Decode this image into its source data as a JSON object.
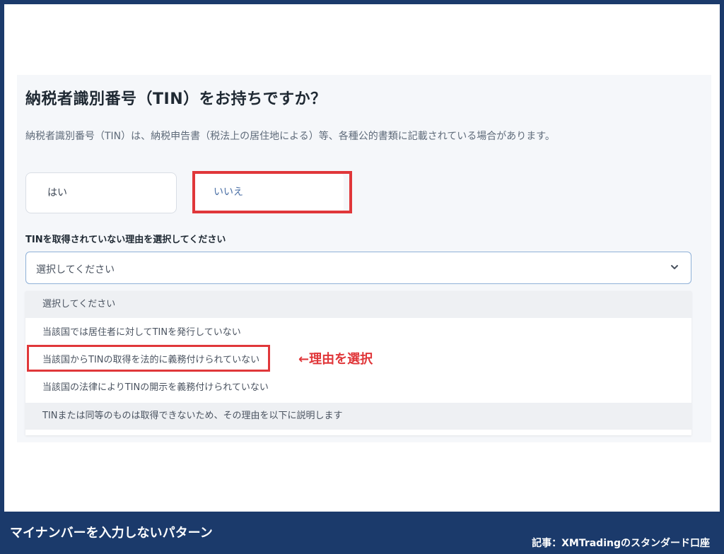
{
  "question": {
    "title": "納税者識別番号（TIN）をお持ちですか？",
    "description": "納税者識別番号（TIN）は、納税申告書（税法上の居住地による）等、各種公的書類に記載されている場合があります。",
    "options": [
      "はい",
      "いいえ"
    ],
    "selected": "いいえ"
  },
  "reason": {
    "label": "TINを取得されていない理由を選択してください",
    "select_value": "選択してください",
    "options": [
      "選択してください",
      "当該国では居住者に対してTINを発行していない",
      "当該国からTINの取得を法的に義務付けられていない",
      "当該国の法律によりTINの開示を義務付けられていない",
      "TINまたは同等のものは取得できないため、その理由を以下に説明します"
    ]
  },
  "annotation": "←理由を選択",
  "footer": {
    "caption": "マイナンバーを入力しないパターン",
    "source": "記事：XMTradingのスタンダード口座"
  },
  "colors": {
    "highlight": "#e0373a",
    "frame": "#1b3a6b"
  }
}
